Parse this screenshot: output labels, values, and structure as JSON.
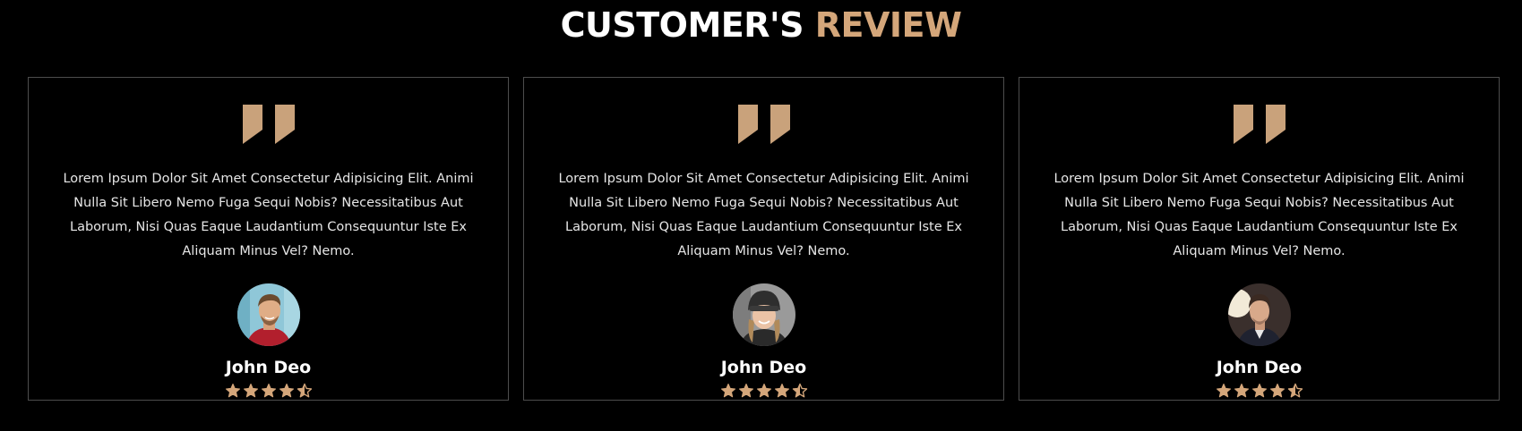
{
  "section": {
    "title_part1": "CUSTOMER'S",
    "title_part2": "REVIEW",
    "accent_color": "#d4a67a"
  },
  "reviews": [
    {
      "text": "Lorem Ipsum Dolor Sit Amet Consectetur Adipisicing Elit. Animi Nulla Sit Libero Nemo Fuga Sequi Nobis? Necessitatibus Aut Laborum, Nisi Quas Eaque Laudantium Consequuntur Iste Ex Aliquam Minus Vel? Nemo.",
      "name": "John Deo",
      "rating": 4.5,
      "avatar_icon": "avatar-man-smiling"
    },
    {
      "text": "Lorem Ipsum Dolor Sit Amet Consectetur Adipisicing Elit. Animi Nulla Sit Libero Nemo Fuga Sequi Nobis? Necessitatibus Aut Laborum, Nisi Quas Eaque Laudantium Consequuntur Iste Ex Aliquam Minus Vel? Nemo.",
      "name": "John Deo",
      "rating": 4.5,
      "avatar_icon": "avatar-woman-beanie"
    },
    {
      "text": "Lorem Ipsum Dolor Sit Amet Consectetur Adipisicing Elit. Animi Nulla Sit Libero Nemo Fuga Sequi Nobis? Necessitatibus Aut Laborum, Nisi Quas Eaque Laudantium Consequuntur Iste Ex Aliquam Minus Vel? Nemo.",
      "name": "John Deo",
      "rating": 4.5,
      "avatar_icon": "avatar-man-suit"
    }
  ]
}
